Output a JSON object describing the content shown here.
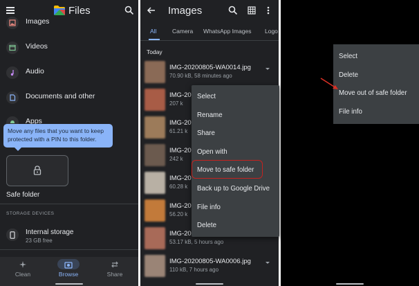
{
  "files_screen": {
    "title": "Files",
    "categories": [
      {
        "label": "Images",
        "icon": "image-icon"
      },
      {
        "label": "Videos",
        "icon": "video-icon"
      },
      {
        "label": "Audio",
        "icon": "music-note-icon"
      },
      {
        "label": "Documents and other",
        "icon": "document-icon"
      },
      {
        "label": "Apps",
        "icon": "android-icon"
      }
    ],
    "tooltip": "Move any files that you want to keep protected with a PIN to this folder.",
    "safe_folder_label": "Safe folder",
    "storage_section_header": "STORAGE DEVICES",
    "internal_storage": {
      "name": "Internal storage",
      "free": "23 GB free"
    },
    "bottom_nav": [
      {
        "label": "Clean",
        "icon": "sparkle-icon",
        "active": false
      },
      {
        "label": "Browse",
        "icon": "browse-icon",
        "active": true
      },
      {
        "label": "Share",
        "icon": "swap-arrows-icon",
        "active": false
      }
    ]
  },
  "images_screen": {
    "title": "Images",
    "tabs": [
      {
        "label": "All",
        "active": true
      },
      {
        "label": "Camera",
        "active": false
      },
      {
        "label": "WhatsApp Images",
        "active": false
      },
      {
        "label": "Logo",
        "active": false
      }
    ],
    "section": "Today",
    "files": [
      {
        "name": "IMG-20200805-WA0014.jpg",
        "meta": "70.90 kB, 58 minutes ago",
        "thumb": "#8a6a56"
      },
      {
        "name": "IMG-20",
        "meta": "207 k",
        "thumb": "#a85c46"
      },
      {
        "name": "IMG-20",
        "meta": "61.21 k",
        "thumb": "#9c7b5a"
      },
      {
        "name": "IMG-20",
        "meta": "242 k",
        "thumb": "#6b5a4e"
      },
      {
        "name": "IMG-20",
        "meta": "60.28 k",
        "thumb": "#b8b0a4"
      },
      {
        "name": "IMG-20",
        "meta": "56.20 k",
        "thumb": "#c27a3a"
      },
      {
        "name": "IMG-20200805-WA0007.jpg",
        "meta": "53.17 kB, 5 hours ago",
        "thumb": "#a86a58"
      },
      {
        "name": "IMG-20200805-WA0006.jpg",
        "meta": "110 kB, 7 hours ago",
        "thumb": "#9a8476"
      }
    ],
    "context_menu": [
      "Select",
      "Rename",
      "Share",
      "Open with",
      "Move to safe folder",
      "Back up to Google Drive",
      "File info",
      "Delete"
    ]
  },
  "safe_folder_screen": {
    "context_menu": [
      "Select",
      "Delete",
      "Move out of safe folder",
      "File info"
    ]
  },
  "colors": {
    "accent": "#8ab4f8",
    "highlight": "#c5221f",
    "background": "#202124",
    "menu": "#3c4043"
  }
}
